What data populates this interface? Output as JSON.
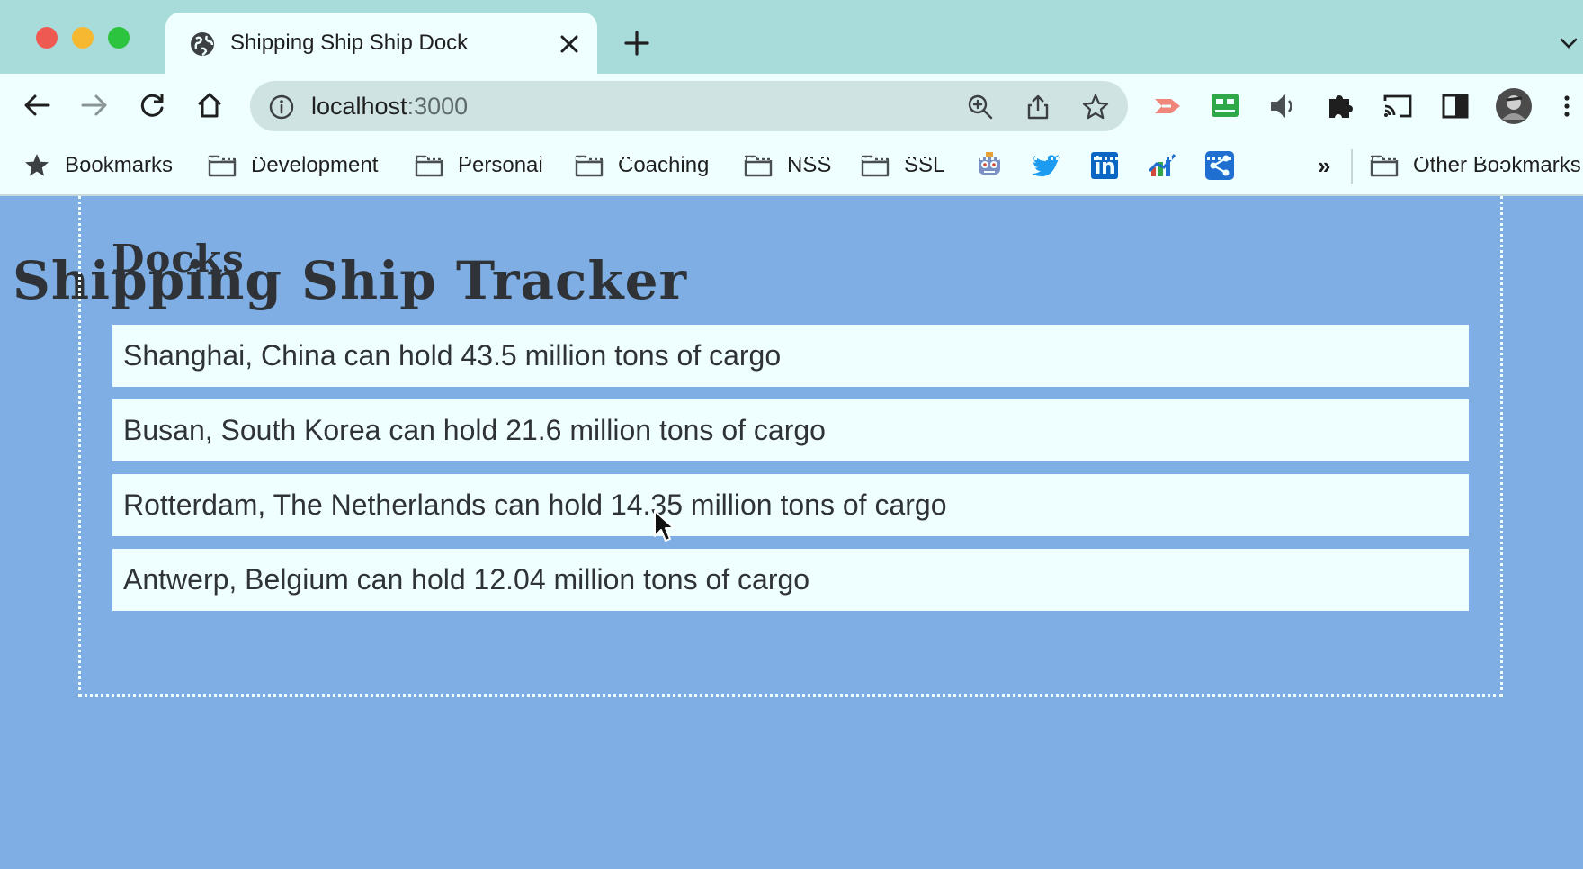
{
  "browser": {
    "tab_title": "Shipping Ship Ship Dock",
    "url_host": "localhost",
    "url_port": ":3000",
    "bookmarks": [
      {
        "label": "Bookmarks",
        "icon": "star-icon"
      },
      {
        "label": "Development",
        "icon": "folder-icon"
      },
      {
        "label": "Personal",
        "icon": "folder-icon"
      },
      {
        "label": "Coaching",
        "icon": "folder-icon"
      },
      {
        "label": "NSS",
        "icon": "folder-icon"
      },
      {
        "label": "SSL",
        "icon": "folder-icon"
      }
    ],
    "bookmark_overflow": "»",
    "other_bookmarks": "Other Bookmarks",
    "colors": {
      "tabstrip": "#a8dcdb",
      "toolbar": "#efffff",
      "omnibox": "#cfe3e3"
    }
  },
  "page": {
    "title": "Shipping Ship Tracker",
    "docks_heading": "Docks",
    "docks": [
      "Shanghai, China can hold 43.5 million tons of cargo",
      "Busan, South Korea can hold 21.6 million tons of cargo",
      "Rotterdam, The Netherlands can hold 14.35 million tons of cargo",
      "Antwerp, Belgium can hold 12.04 million tons of cargo"
    ],
    "colors": {
      "background": "#7eaee3",
      "item_background": "#efffff",
      "text": "#2f3338"
    }
  }
}
